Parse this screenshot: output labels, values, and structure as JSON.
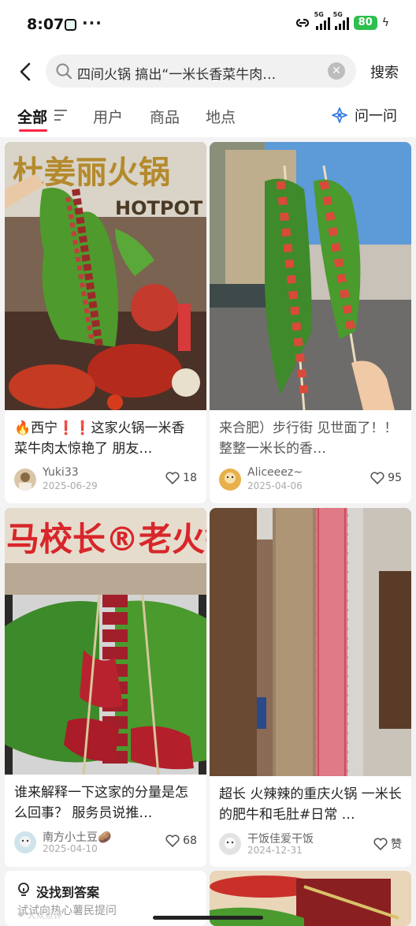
{
  "status_bar": {
    "time": "8:07",
    "more": "···",
    "sig1_tag": "5G",
    "sig2_tag": "5G",
    "battery": "80",
    "bolt": "ϟ"
  },
  "search": {
    "query": "四间火锅 搞出“一米长香菜牛肉…",
    "clear": "✕",
    "button_label": "搜索"
  },
  "tabs": {
    "items": [
      "全部",
      "用户",
      "商品",
      "地点"
    ],
    "active": "全部",
    "ask_label": "问一问"
  },
  "posts": [
    {
      "title_prefix_icon": "🔥",
      "title": "🔥西宁❗❗这家火锅一米香菜牛肉太惊艳了 朋友…",
      "author": "Yuki33",
      "date": "2025-06-29",
      "likes": "18"
    },
    {
      "title": "来合肥）步行街 见世面了！！ 整整一米长的香…",
      "author": "Aliceeez~",
      "date": "2025-04-06",
      "likes": "95"
    },
    {
      "title": "谁来解释一下这家的分量是怎么回事？ 服务员说推…",
      "author": "南方小土豆🥔",
      "date": "2025-04-10",
      "likes": "68"
    },
    {
      "title": "超长 火辣辣的重庆火锅 一米长的肥牛和毛肚#日常 …",
      "author": "干饭佳爱干饭",
      "date": "2024-12-31",
      "likes": "赞"
    }
  ],
  "sign_text": {
    "store1": "杜姜丽火锅",
    "store1_en": "HOTPOT",
    "store3": "马校长®老火锅"
  },
  "faq": {
    "title": "没找到答案",
    "subtitle": "试试向热心薯民提问"
  },
  "watermark": "❤ 大众点评",
  "colors": {
    "accent": "#ff2442",
    "battery": "#2fbf4f",
    "ask_icon": "#3b7ddd"
  }
}
